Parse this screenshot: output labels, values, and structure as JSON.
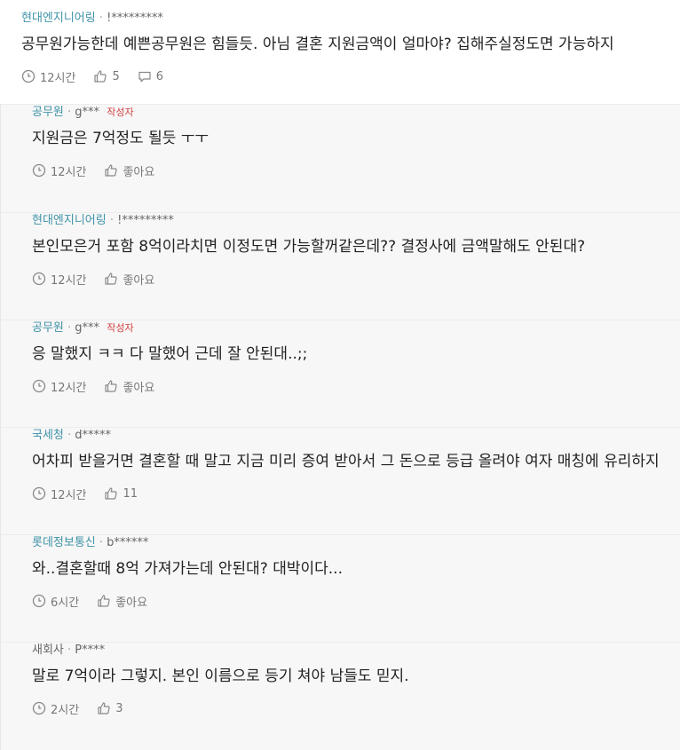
{
  "comments": [
    {
      "company": "현대엔지니어링",
      "user": "!*********",
      "author_tag": "",
      "text": "공무원가능한데 예쁜공무원은 힘들듯. 아님 결혼 지원금액이 얼마야? 집해주실정도면 가능하지",
      "time": "12시간",
      "likes": "5",
      "replies": "6"
    }
  ],
  "replies": [
    {
      "company": "공무원",
      "user": "g***",
      "author_tag": "작성자",
      "text": "지원금은 7억정도 될듯 ㅜㅜ",
      "time": "12시간",
      "likes": "좋아요"
    },
    {
      "company": "현대엔지니어링",
      "user": "!*********",
      "author_tag": "",
      "text": "본인모은거 포함 8억이라치면 이정도면 가능할꺼같은데?? 결정사에 금액말해도 안된대?",
      "time": "12시간",
      "likes": "좋아요"
    },
    {
      "company": "공무원",
      "user": "g***",
      "author_tag": "작성자",
      "text": "응 말했지 ㅋㅋ 다 말했어 근데 잘 안된대..;;",
      "time": "12시간",
      "likes": "좋아요"
    },
    {
      "company": "국세청",
      "user": "d*****",
      "author_tag": "",
      "text": "어차피 받을거면 결혼할 때 말고 지금 미리 증여 받아서 그 돈으로 등급 올려야 여자 매칭에 유리하지",
      "time": "12시간",
      "likes": "11"
    },
    {
      "company": "롯데정보통신",
      "user": "b******",
      "author_tag": "",
      "text": "와..결혼할때 8억 가져가는데 안된대? 대박이다...",
      "time": "6시간",
      "likes": "좋아요"
    },
    {
      "company": "새회사",
      "user": "P****",
      "author_tag": "",
      "text": "말로 7억이라 그렇지. 본인 이름으로 등기 쳐야 남들도 믿지.",
      "time": "2시간",
      "likes": "3"
    }
  ],
  "icons": {
    "clock": "clock-icon",
    "like": "thumbs-up-icon",
    "comment": "comment-bubble-icon"
  },
  "colors": {
    "company": "#3f93a8",
    "author_tag": "#d23f3f",
    "reply_bg": "#f7f7f7"
  }
}
